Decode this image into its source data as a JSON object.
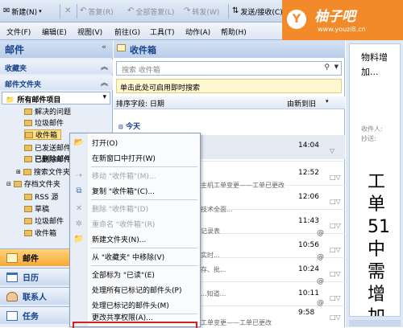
{
  "toolbar": {
    "new_label": "新建(N)",
    "reply_label": "答复(R)",
    "reply_all_label": "全部答复(L)",
    "forward_label": "转发(W)",
    "send_receive_label": "发送/接收(C)"
  },
  "menubar": {
    "items": [
      "文件(F)",
      "编辑(E)",
      "视图(V)",
      "前往(G)",
      "工具(T)",
      "动作(A)",
      "帮助(H)"
    ]
  },
  "watermark": {
    "badge": "Y",
    "title": "柚子吧",
    "url": "www.youzi8.cn"
  },
  "nav": {
    "title": "邮件",
    "favorites_label": "收藏夹",
    "mail_folders_label": "邮件文件夹",
    "all_items_label": "所有邮件项目",
    "folders": [
      "解决的问题",
      "垃圾邮件",
      "收件箱",
      "已发送邮件",
      "已删除邮件",
      "搜索文件夹",
      "存档文件夹",
      "RSS 源",
      "草稿",
      "垃圾邮件",
      "收件箱"
    ],
    "buttons": [
      "邮件",
      "日历",
      "联系人",
      "任务"
    ]
  },
  "list": {
    "title": "收件箱",
    "search_placeholder": "搜索 收件箱",
    "instant_search_bar": "单击此处可启用即时搜索",
    "sort_label": "排序字段: 日期",
    "sort_order": "由新到旧",
    "group_today": "今天",
    "times": [
      "14:04",
      "12:52",
      "12:06",
      "11:43",
      "10:56",
      "10:24",
      "10:11",
      "9:58"
    ],
    "snippets": [
      "主机工单变更——工单已更改",
      "技术全面...",
      "记录表",
      "实时...",
      "存、批...",
      "...知道...",
      "工单变更——工单已更改"
    ]
  },
  "reading": {
    "subject": "物料增加...",
    "recipient_label": "收件人:",
    "cc_label": "抄送:",
    "body_chars": [
      "工",
      "单",
      "51",
      "中",
      "需",
      "增",
      "加"
    ]
  },
  "context_menu": {
    "items": [
      {
        "label": "打开(O)",
        "disabled": false,
        "icon": "open-icon"
      },
      {
        "label": "在新窗口中打开(W)",
        "disabled": false,
        "icon": ""
      },
      {
        "label": "移动 \"收件箱\"(M)...",
        "disabled": true,
        "icon": "move-icon"
      },
      {
        "label": "复制 \"收件箱\"(C)...",
        "disabled": false,
        "icon": "copy-icon"
      },
      {
        "label": "删除 \"收件箱\"(D)",
        "disabled": true,
        "icon": "delete-icon"
      },
      {
        "label": "重命名 \"收件箱\"(R)",
        "disabled": true,
        "icon": "rename-icon"
      },
      {
        "label": "新建文件夹(N)...",
        "disabled": false,
        "icon": "new-folder-icon"
      },
      {
        "label": "从 \"收藏夹\" 中移除(V)",
        "disabled": false,
        "icon": ""
      },
      {
        "label": "全部标为 \"已读\"(E)",
        "disabled": false,
        "icon": ""
      },
      {
        "label": "处理所有已标记的邮件头(P)",
        "disabled": false,
        "icon": ""
      },
      {
        "label": "处理已标记的邮件头(M)",
        "disabled": false,
        "icon": ""
      },
      {
        "label": "更改共享权限(A)...",
        "disabled": false,
        "icon": ""
      }
    ]
  },
  "colors": {
    "accent": "#15428b",
    "highlight": "#d92020",
    "selected_folder": "#ffe18a",
    "active_nav": "#f7a935",
    "watermark": "#f28a2a"
  }
}
